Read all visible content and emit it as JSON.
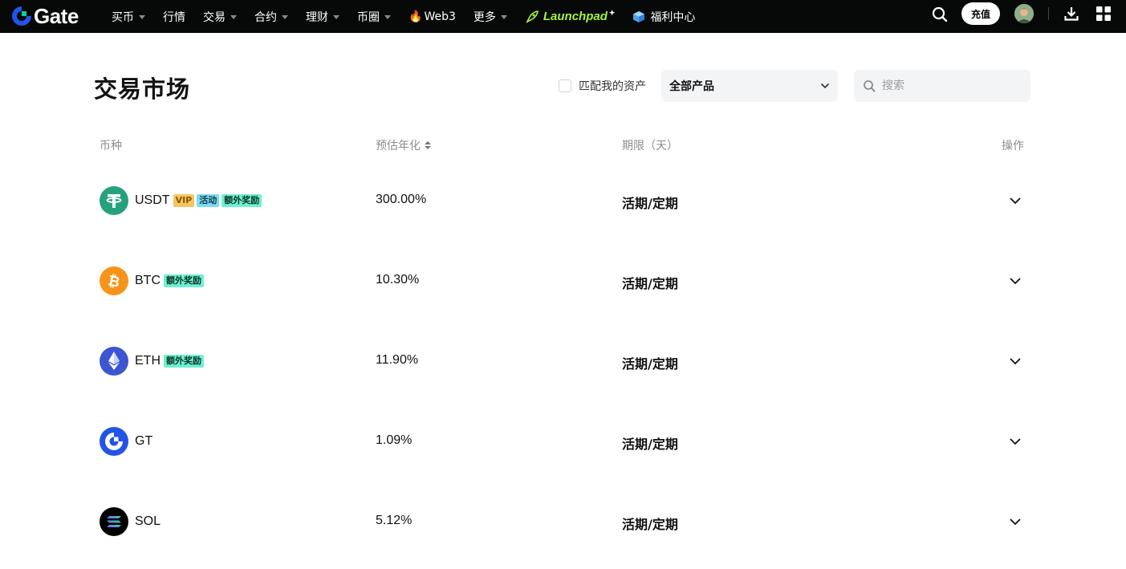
{
  "nav": {
    "logo_text": "Gate",
    "items": [
      {
        "label": "买币",
        "caret": true
      },
      {
        "label": "行情",
        "caret": false
      },
      {
        "label": "交易",
        "caret": true
      },
      {
        "label": "合约",
        "caret": true
      },
      {
        "label": "理财",
        "caret": true
      },
      {
        "label": "币圈",
        "caret": true
      },
      {
        "label": "Web3",
        "caret": false
      },
      {
        "label": "更多",
        "caret": true
      }
    ],
    "launchpad_label": "Launchpad",
    "welfare_label": "福利中心",
    "deposit_label": "充值",
    "brand_color": "#2354E6",
    "launchpad_color": "#A3F53B"
  },
  "page": {
    "title": "交易市场",
    "match_assets_label": "匹配我的资产",
    "product_select_value": "全部产品",
    "search_placeholder": "搜索"
  },
  "table": {
    "headers": {
      "coin": "币种",
      "apr": "预估年化",
      "term": "期限（天）",
      "action": "操作"
    },
    "rows": [
      {
        "coin": "USDT",
        "icon": "usdt-icon",
        "tags": [
          "VIP",
          "活动",
          "额外奖励"
        ],
        "apr": "300.00%",
        "term": "活期/定期"
      },
      {
        "coin": "BTC",
        "icon": "btc-icon",
        "tags": [
          "额外奖励"
        ],
        "apr": "10.30%",
        "term": "活期/定期"
      },
      {
        "coin": "ETH",
        "icon": "eth-icon",
        "tags": [
          "额外奖励"
        ],
        "apr": "11.90%",
        "term": "活期/定期"
      },
      {
        "coin": "GT",
        "icon": "gt-icon",
        "tags": [],
        "apr": "1.09%",
        "term": "活期/定期"
      },
      {
        "coin": "SOL",
        "icon": "sol-icon",
        "tags": [],
        "apr": "5.12%",
        "term": "活期/定期"
      }
    ]
  }
}
